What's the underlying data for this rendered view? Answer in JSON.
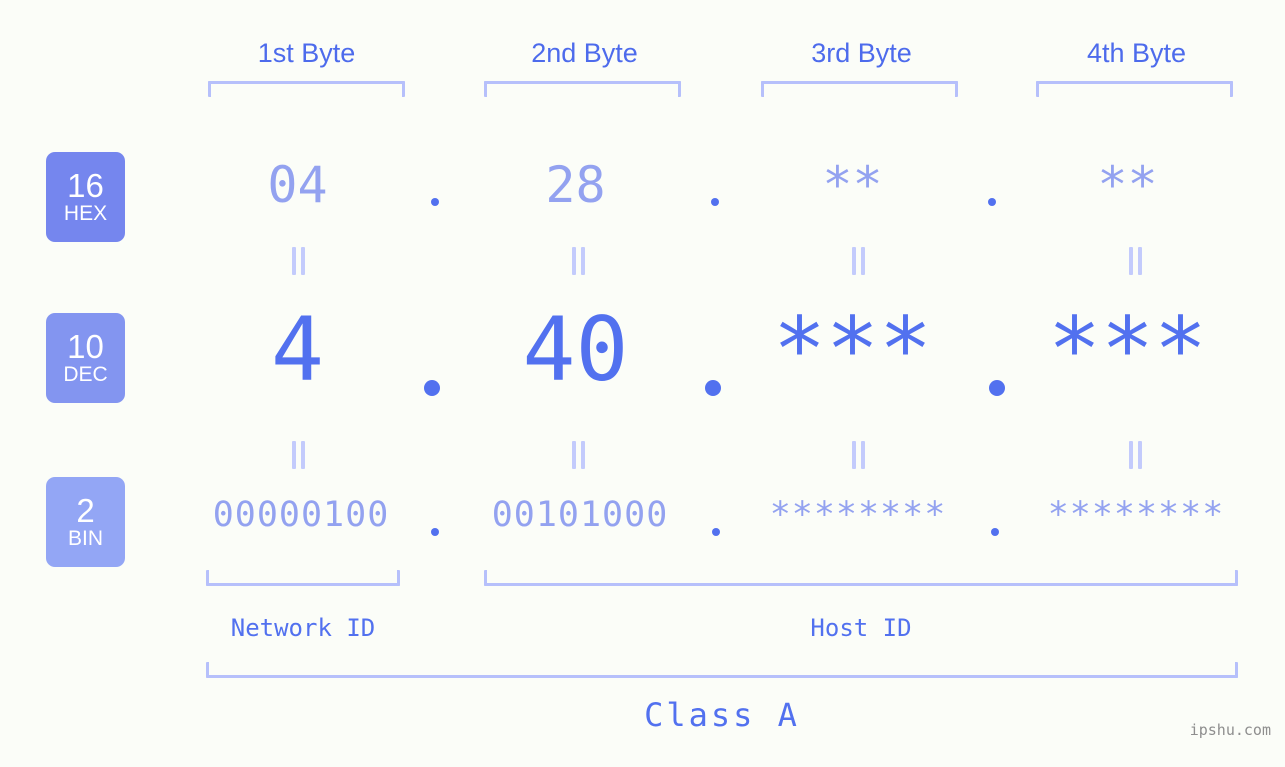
{
  "colors": {
    "background": "#fbfdf8",
    "accent_strong": "#5271ef",
    "accent_header": "#4d6bec",
    "accent_light": "#93a2f0",
    "bracket": "#b6c0fb",
    "eq_bar": "#c3cbfc",
    "badge_hex": "#7586ee",
    "badge_dec": "#8395f0",
    "badge_bin": "#93a6f5",
    "watermark": "#8e8e8e"
  },
  "headers": [
    {
      "label": "1st Byte"
    },
    {
      "label": "2nd Byte"
    },
    {
      "label": "3rd Byte"
    },
    {
      "label": "4th Byte"
    }
  ],
  "bases": [
    {
      "number": "16",
      "name": "HEX"
    },
    {
      "number": "10",
      "name": "DEC"
    },
    {
      "number": "2",
      "name": "BIN"
    }
  ],
  "rows": {
    "hex": {
      "base_number": "16",
      "base_name": "HEX",
      "values": [
        "04",
        "28",
        "**",
        "**"
      ]
    },
    "dec": {
      "base_number": "10",
      "base_name": "DEC",
      "values": [
        "4",
        "40",
        "***",
        "***"
      ]
    },
    "bin": {
      "base_number": "2",
      "base_name": "BIN",
      "values": [
        "00000100",
        "00101000",
        "********",
        "********"
      ]
    }
  },
  "separators": {
    "dot": ".",
    "equals": "||"
  },
  "sections": [
    {
      "label": "Network ID"
    },
    {
      "label": "Host ID"
    }
  ],
  "class": {
    "label": "Class A"
  },
  "watermark": {
    "text": "ipshu.com"
  }
}
